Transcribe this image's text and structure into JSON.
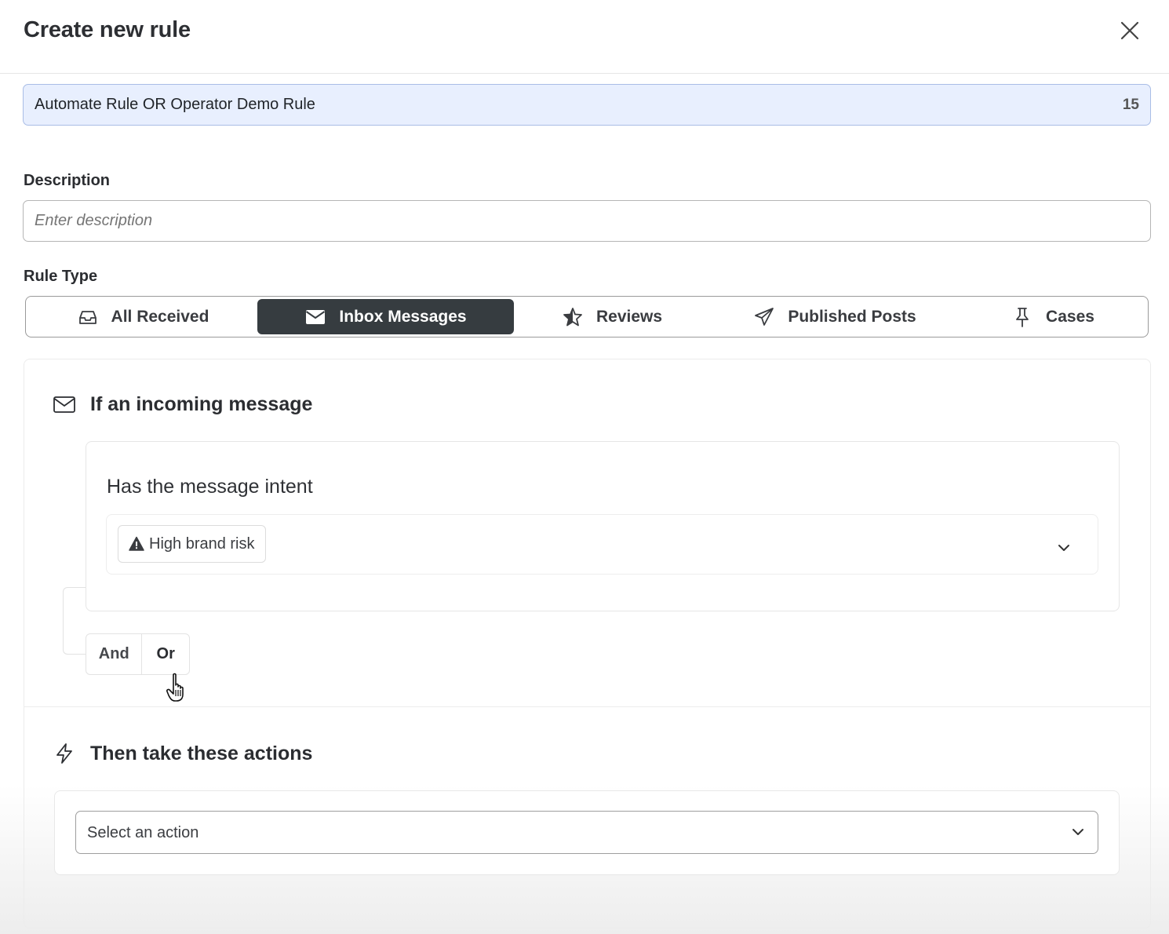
{
  "modal": {
    "title": "Create new rule"
  },
  "rule_name": {
    "value": "Automate Rule OR Operator Demo Rule",
    "count": "15"
  },
  "description": {
    "label": "Description",
    "placeholder": "Enter description",
    "value": ""
  },
  "rule_type": {
    "label": "Rule Type",
    "options": [
      {
        "label": "All Received",
        "icon": "inbox-tray-icon",
        "selected": false
      },
      {
        "label": "Inbox Messages",
        "icon": "envelope-icon",
        "selected": true
      },
      {
        "label": "Reviews",
        "icon": "star-icon",
        "selected": false
      },
      {
        "label": "Published Posts",
        "icon": "paper-plane-icon",
        "selected": false
      },
      {
        "label": "Cases",
        "icon": "pin-icon",
        "selected": false
      }
    ]
  },
  "condition": {
    "heading": "If an incoming message",
    "heading_icon": "envelope-icon",
    "title": "Has the message intent",
    "chip": {
      "label": "High brand risk",
      "icon": "warning-triangle-icon"
    },
    "operators": {
      "and": "And",
      "or": "Or"
    }
  },
  "actions": {
    "heading": "Then take these actions",
    "heading_icon": "lightning-bolt-icon",
    "select_text": "Select an action"
  },
  "colors": {
    "active_tab_bg": "#363c40",
    "name_field_bg": "#e8effe",
    "name_field_border": "#a9bde6"
  }
}
